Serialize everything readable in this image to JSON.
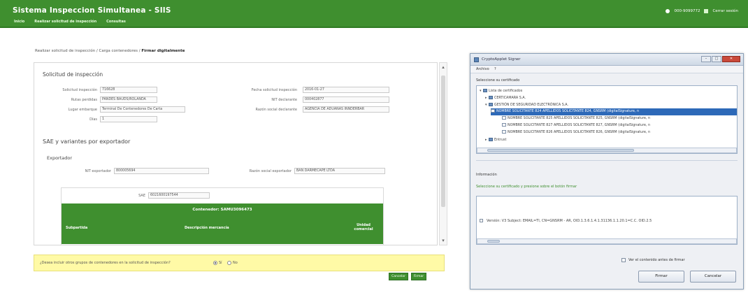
{
  "app": {
    "title": "Sistema Inspeccion Simultanea - SIIS",
    "menu": [
      "Inicio",
      "Realizar solicitud de inspección",
      "Consultas"
    ],
    "user": "000-9099772",
    "logout": "Cerrar sesión"
  },
  "breadcrumb": {
    "path": "Realizar solicitud de inspección / Carga contenedores / ",
    "current": "Firmar digitalmente"
  },
  "request": {
    "section_title": "Solicitud de inspección",
    "fields": [
      {
        "label": "Solicitud inspección",
        "value": "716628"
      },
      {
        "label": "Fecha solicitud inspección",
        "value": "2016-01-27"
      },
      {
        "label": "Rutas perdidas",
        "value": "PANDES BAUDS/ROLANDA"
      },
      {
        "label": "NIT declarante",
        "value": "000402877"
      },
      {
        "label": "Lugar embarque",
        "value": "Terminal De Contenedores De Carta"
      },
      {
        "label": "Razón social declarante",
        "value": "AGENCIA DE ADUANAS INNDERBAR"
      },
      {
        "label": "Días",
        "value": "1"
      }
    ]
  },
  "sae": {
    "section_title": "SAE y variantes por exportador",
    "exporter_title": "Exportador",
    "nit_label": "NIT exportador",
    "nit_value": "800005694",
    "razon_label": "Razón social exportador",
    "razon_value": "BAN DARMECAPE LTDA",
    "sae_label": "SAE",
    "sae_value": "6021600197544",
    "green_title": "Contenedor: SAMU3096473",
    "col_1": "Subpartida",
    "col_2": "Descripción mercancía",
    "col_3": "Unidad comercial"
  },
  "prompt": {
    "text": "¿Desea incluir otros grupos de contenedores en la solicitud de inspección?",
    "yes": "Sí",
    "no": "No"
  },
  "buttons": {
    "cancel": "Cancelar",
    "finish": "Firmar"
  },
  "dialog": {
    "title": "CryptoApplet Signer",
    "menu": [
      "Archivo",
      "?"
    ],
    "select_label": "Seleccione su certificado",
    "tree": {
      "root": "Lista de certificados",
      "issuer_1": "CERTICAMARA S.A.",
      "issuer_2": "GESTIÓN DE SEGURIDAD ELECTRÓNICA S.A.",
      "certs": [
        "NOMBRE SOLICITANTE 824 APELLIDOS SOLICITANTE 824, GNSRM (digitalSignature, n",
        "NOMBRE SOLICITANTE 825 APELLIDOS SOLICITANTE 825, GNSRM (digitalSignature, n",
        "NOMBRE SOLICITANTE 827 APELLIDOS SOLICITANTE 827, GNSRM (digitalSignature, n",
        "NOMBRE SOLICITANTE 826 APELLIDOS SOLICITANTE 826, GNSRM (digitalSignature, n"
      ],
      "more": "Entrust"
    },
    "info_label": "Información",
    "hint": "Seleccione su certificado y presione sobre el botón firmar",
    "info_text": "Versión: V3   Subject: EMAIL=TI, CN=GNSRM - AR, OID.1.3.6.1.4.1.31136.1.1.20.1=C.C. OID.2.5",
    "checkbox_label": "Ver el contenido antes de firmar",
    "sign": "Firmar",
    "cancel": "Cancelar"
  }
}
